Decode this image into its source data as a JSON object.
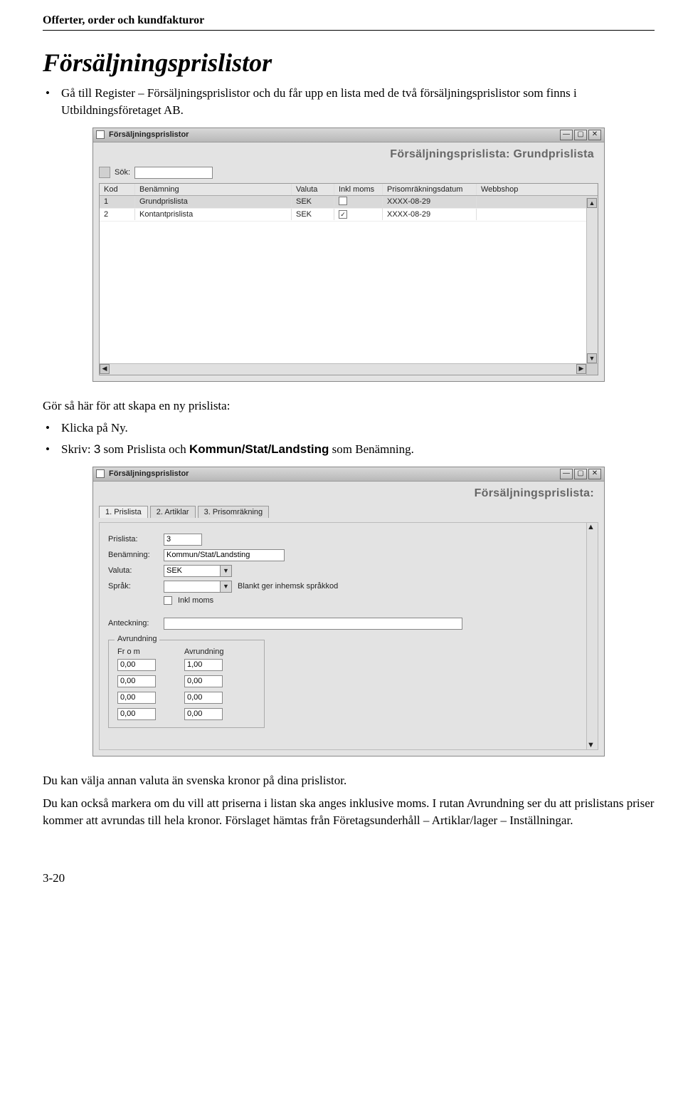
{
  "running_head": "Offerter, order och kundfakturor",
  "section_title": "Försäljningsprislistor",
  "intro_bullet": "Gå till Register – Försäljningsprislistor och du får upp en lista med de två försäljningsprislistor som finns i Utbildningsföretaget AB.",
  "mid_text": "Gör så här för att skapa en ny prislista:",
  "mid_bullets": {
    "b1": "Klicka på Ny.",
    "b2_pre": "Skriv: ",
    "b2_code": "3",
    "b2_mid": " som Prislista och ",
    "b2_bold": "Kommun/Stat/Landsting",
    "b2_post": " som Benämning."
  },
  "closing": {
    "p1": "Du kan välja annan valuta än svenska kronor på dina prislistor.",
    "p2": "Du kan också markera om du vill att priserna i listan ska anges inklusive moms. I rutan Avrundning ser du att prislistans priser kommer att avrundas till hela kronor. Förslaget hämtas från Företagsunderhåll – Artiklar/lager – Inställningar."
  },
  "page_num": "3-20",
  "window1": {
    "title": "Försäljningsprislistor",
    "banner": "Försäljningsprislista: Grundprislista",
    "search_label": "Sök:",
    "headers": [
      "Kod",
      "Benämning",
      "Valuta",
      "Inkl moms",
      "Prisomräkningsdatum",
      "Webbshop"
    ],
    "rows": [
      {
        "kod": "1",
        "ben": "Grundprislista",
        "valuta": "SEK",
        "inkl": false,
        "datum": "XXXX-08-29",
        "web": ""
      },
      {
        "kod": "2",
        "ben": "Kontantprislista",
        "valuta": "SEK",
        "inkl": true,
        "datum": "XXXX-08-29",
        "web": ""
      }
    ]
  },
  "window2": {
    "title": "Försäljningsprislistor",
    "banner": "Försäljningsprislista:",
    "tabs": [
      "1. Prislista",
      "2. Artiklar",
      "3. Prisomräkning"
    ],
    "labels": {
      "prislista": "Prislista:",
      "benamning": "Benämning:",
      "valuta": "Valuta:",
      "sprak": "Språk:",
      "hint": "Blankt ger inhemsk språkkod",
      "inklmoms": "Inkl moms",
      "anteckning": "Anteckning:",
      "avrundning": "Avrundning",
      "from": "Fr o m",
      "avr": "Avrundning"
    },
    "values": {
      "prislista": "3",
      "benamning": "Kommun/Stat/Landsting",
      "valuta": "SEK",
      "sprak": ""
    },
    "rounding": [
      {
        "a": "0,00",
        "b": "1,00"
      },
      {
        "a": "0,00",
        "b": "0,00"
      },
      {
        "a": "0,00",
        "b": "0,00"
      },
      {
        "a": "0,00",
        "b": "0,00"
      }
    ]
  }
}
